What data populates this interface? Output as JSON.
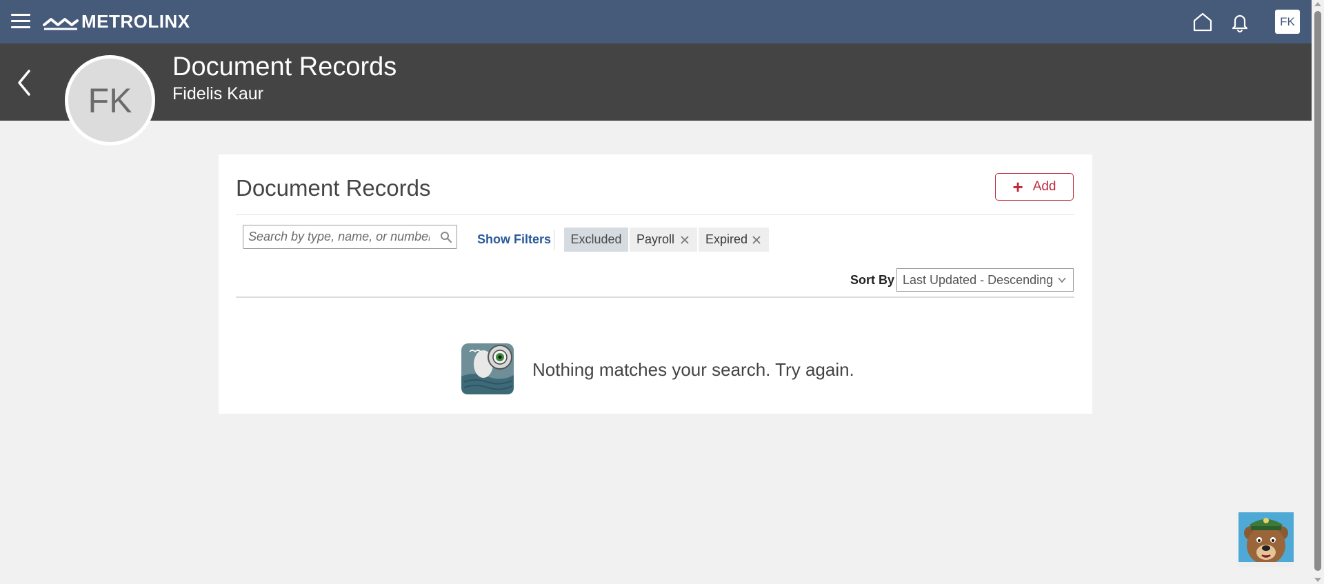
{
  "topbar": {
    "brand": "METROLINX",
    "user_initials": "FK",
    "icons": [
      "menu-icon",
      "home-icon",
      "bell-icon"
    ],
    "color": "#465a7a"
  },
  "header": {
    "title": "Document Records",
    "subtitle": "Fidelis Kaur",
    "avatar_initials": "FK",
    "color": "#444444"
  },
  "card": {
    "title": "Document Records",
    "add_label": "Add",
    "search_placeholder": "Search by type, name, or number",
    "show_filters_label": "Show Filters",
    "chips": [
      {
        "label": "Excluded",
        "removable": false
      },
      {
        "label": "Payroll",
        "removable": true
      },
      {
        "label": "Expired",
        "removable": true
      }
    ],
    "sort_label": "Sort By",
    "sort_value": "Last Updated - Descending",
    "empty_message": "Nothing matches your search. Try again."
  },
  "colors": {
    "accent_red": "#c0293b",
    "link_blue": "#2a5a9a",
    "page_bg": "#f1f1f1"
  }
}
